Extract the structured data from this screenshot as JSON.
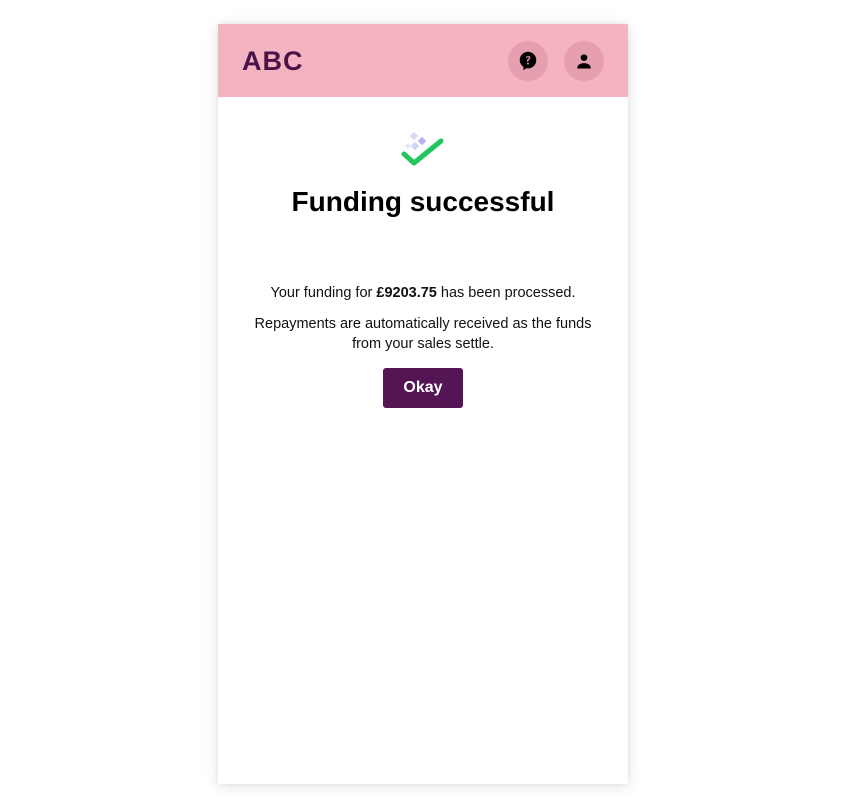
{
  "header": {
    "logo_text": "ABC",
    "help_icon": "help-bubble-icon",
    "account_icon": "person-icon",
    "background_color": "#f3b3c0",
    "icon_button_color": "#e69fae",
    "logo_color": "#4a1248"
  },
  "main": {
    "status_icon": "success-check-icon",
    "title": "Funding successful",
    "funding_prefix": "Your funding for ",
    "funding_amount": "£9203.75",
    "funding_suffix": " has been processed.",
    "repayment_note": "Repayments are automatically received as the funds from your sales settle.",
    "okay_label": "Okay",
    "button_color": "#531553",
    "check_color": "#22c55e"
  }
}
